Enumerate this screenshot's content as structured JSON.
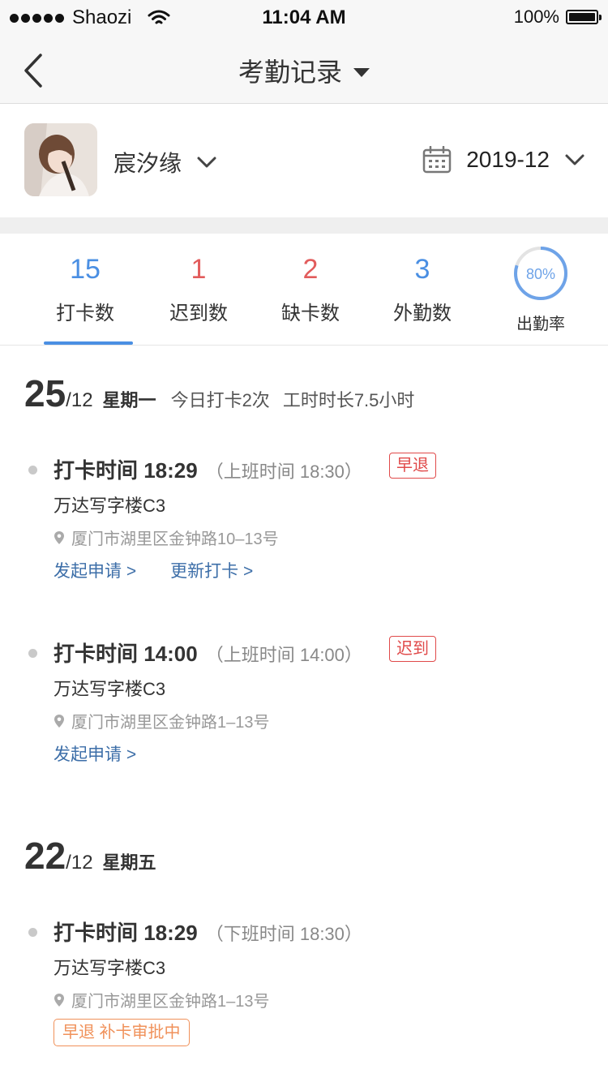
{
  "status_bar": {
    "carrier": "Shaozi",
    "time": "11:04 AM",
    "battery": "100%"
  },
  "nav": {
    "title": "考勤记录"
  },
  "user": {
    "name": "宸汐缘",
    "date": "2019-12"
  },
  "stats": [
    {
      "value": "15",
      "label": "打卡数",
      "color": "#4a8fe3"
    },
    {
      "value": "1",
      "label": "迟到数",
      "color": "#e25c5c"
    },
    {
      "value": "2",
      "label": "缺卡数",
      "color": "#e25c5c"
    },
    {
      "value": "3",
      "label": "外勤数",
      "color": "#4a8fe3"
    }
  ],
  "rate": {
    "value": "80%",
    "label": "出勤率",
    "fraction": 0.8,
    "color": "#6ea3e8"
  },
  "days": [
    {
      "day": "25",
      "month": "/12",
      "weekday": "星期一",
      "info1": "今日打卡2次",
      "info2": "工时时长7.5小时",
      "records": [
        {
          "time": "打卡时间 18:29",
          "shift": "（上班时间 18:30）",
          "badge": "早退",
          "building": "万达写字楼C3",
          "address": "厦门市湖里区金钟路10–13号",
          "links": [
            "发起申请 >",
            "更新打卡 >"
          ]
        },
        {
          "time": "打卡时间 14:00",
          "shift": "（上班时间 14:00）",
          "badge": "迟到",
          "building": "万达写字楼C3",
          "address": "厦门市湖里区金钟路1–13号",
          "links": [
            "发起申请 >"
          ]
        }
      ]
    },
    {
      "day": "22",
      "month": "/12",
      "weekday": "星期五",
      "records": [
        {
          "time": "打卡时间 18:29",
          "shift": "（下班时间 18:30）",
          "building": "万达写字楼C3",
          "address": "厦门市湖里区金钟路1–13号",
          "approval": "早退 补卡审批中"
        }
      ]
    }
  ]
}
